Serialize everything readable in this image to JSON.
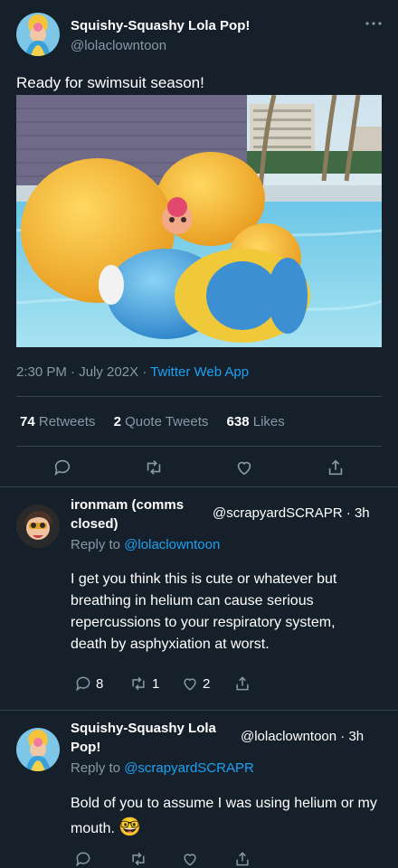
{
  "tweet": {
    "display_name": "Squishy-Squashy Lola Pop!",
    "handle": "@lolaclowntoon",
    "text": "Ready for swimsuit season!",
    "time": "2:30 PM",
    "date": "July 202X",
    "separator": "·",
    "source": "Twitter Web App",
    "stats": {
      "retweets_count": "74",
      "retweets_label": "Retweets",
      "quotes_count": "2",
      "quotes_label": "Quote Tweets",
      "likes_count": "638",
      "likes_label": "Likes"
    },
    "more_icon": "more-dots-icon"
  },
  "replies": [
    {
      "display_name_line1": "ironmam (comms",
      "display_name_line2": "closed)",
      "handle": "@scrapyardSCRAPR",
      "time": "· 3h",
      "reply_to_prefix": "Reply to",
      "reply_to_handle": "@lolaclowntoon",
      "text": "I get you think this is cute or whatever but breathing in helium can cause serious repercussions to your respiratory system, death by asphyxiation at worst.",
      "reply_count": "8",
      "retweet_count": "1",
      "like_count": "2"
    },
    {
      "display_name_line1": "Squishy-Squashy Lola",
      "display_name_line2": "Pop!",
      "handle": "@lolaclowntoon",
      "time": "· 3h",
      "reply_to_prefix": "Reply to",
      "reply_to_handle": "@scrapyardSCRAPR",
      "text": "Bold of you to assume I was using helium or my mouth.",
      "emoji": "🤓"
    }
  ],
  "colors": {
    "background": "#15202b",
    "accent": "#1da1f2",
    "muted": "#8899a6",
    "divider": "#38444d"
  }
}
